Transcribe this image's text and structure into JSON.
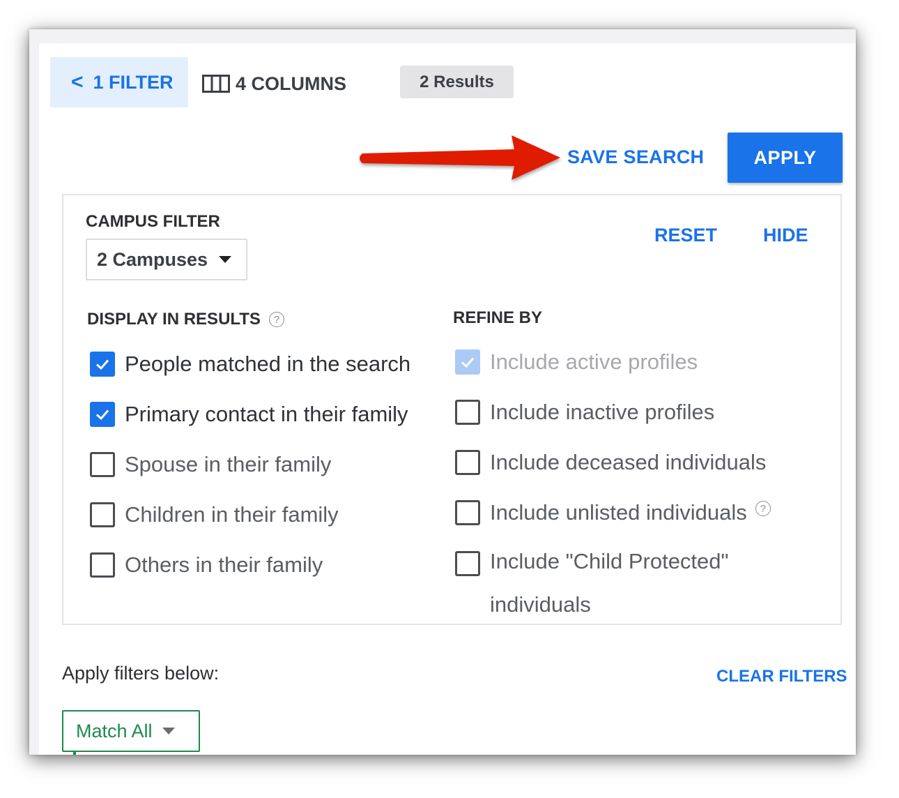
{
  "toolbar": {
    "filter_label": "1 FILTER",
    "columns_label": "4 COLUMNS",
    "results_label": "2 Results",
    "save_search_label": "SAVE SEARCH",
    "apply_label": "APPLY"
  },
  "campus": {
    "label": "CAMPUS FILTER",
    "selected": "2 Campuses"
  },
  "actions": {
    "reset_label": "RESET",
    "hide_label": "HIDE"
  },
  "display": {
    "title": "DISPLAY IN RESULTS",
    "items": [
      {
        "label": "People matched in the search",
        "checked": true
      },
      {
        "label": "Primary contact in their family",
        "checked": true
      },
      {
        "label": "Spouse in their family",
        "checked": false
      },
      {
        "label": "Children in their family",
        "checked": false
      },
      {
        "label": "Others in their family",
        "checked": false
      }
    ]
  },
  "refine": {
    "title": "REFINE BY",
    "items": [
      {
        "label": "Include active profiles",
        "checked": true,
        "disabled": true
      },
      {
        "label": "Include inactive profiles",
        "checked": false
      },
      {
        "label": "Include deceased individuals",
        "checked": false
      },
      {
        "label": "Include unlisted individuals",
        "checked": false
      },
      {
        "label": "Include \"Child Protected\" individuals",
        "checked": false
      }
    ]
  },
  "filters": {
    "apply_below_label": "Apply filters below:",
    "clear_label": "CLEAR FILTERS",
    "match_selected": "Match All"
  },
  "colors": {
    "accent": "#1a73e8",
    "accent_light": "#e3effd",
    "success": "#1e8a4c",
    "annotation_arrow": "#e01a00"
  },
  "icons": {
    "back": "chevron-left-icon",
    "columns": "columns-icon",
    "help": "help-circle-icon",
    "dropdown": "caret-down-icon",
    "check": "checkmark-icon"
  }
}
